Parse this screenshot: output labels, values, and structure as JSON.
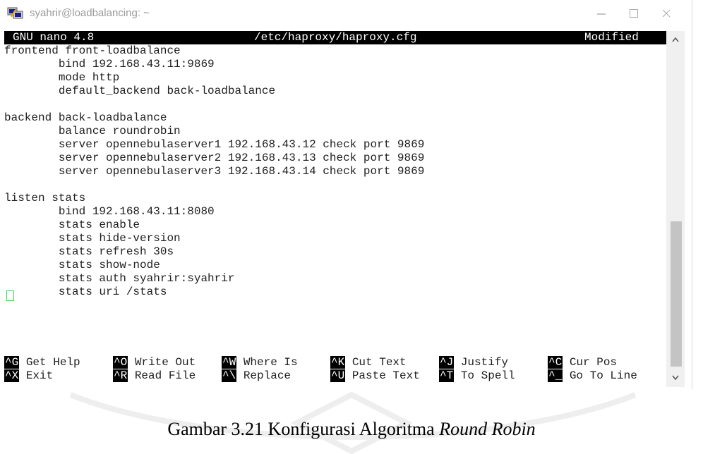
{
  "window": {
    "title": "syahrir@loadbalancing: ~",
    "icons": {
      "app": "putty-icon",
      "minimize": "minimize-icon",
      "maximize": "maximize-icon",
      "close": "close-icon"
    }
  },
  "nano": {
    "version": "GNU nano 4.8",
    "filename": "/etc/haproxy/haproxy.cfg",
    "status": "Modified"
  },
  "config_lines": [
    "frontend front-loadbalance",
    "        bind 192.168.43.11:9869",
    "        mode http",
    "        default_backend back-loadbalance",
    "",
    "backend back-loadbalance",
    "        balance roundrobin",
    "        server opennebulaserver1 192.168.43.12 check port 9869",
    "        server opennebulaserver2 192.168.43.13 check port 9869",
    "        server opennebulaserver3 192.168.43.14 check port 9869",
    "",
    "listen stats",
    "        bind 192.168.43.11:8080",
    "        stats enable",
    "        stats hide-version",
    "        stats refresh 30s",
    "        stats show-node",
    "        stats auth syahrir:syahrir",
    "        stats uri /stats"
  ],
  "shortcuts_row1": [
    {
      "key": "^G",
      "label": "Get Help"
    },
    {
      "key": "^O",
      "label": "Write Out"
    },
    {
      "key": "^W",
      "label": "Where Is"
    },
    {
      "key": "^K",
      "label": "Cut Text"
    },
    {
      "key": "^J",
      "label": "Justify"
    },
    {
      "key": "^C",
      "label": "Cur Pos"
    }
  ],
  "shortcuts_row2": [
    {
      "key": "^X",
      "label": "Exit"
    },
    {
      "key": "^R",
      "label": "Read File"
    },
    {
      "key": "^\\",
      "label": "Replace"
    },
    {
      "key": "^U",
      "label": "Paste Text"
    },
    {
      "key": "^T",
      "label": "To Spell"
    },
    {
      "key": "^_",
      "label": "Go To Line"
    }
  ],
  "caption": {
    "prefix": "Gambar 3.21 Konfigurasi Algoritma ",
    "emphasis": "Round Robin"
  },
  "colors": {
    "cursor": "#3fd64f",
    "header_bg": "#000000",
    "header_fg": "#ffffff"
  }
}
